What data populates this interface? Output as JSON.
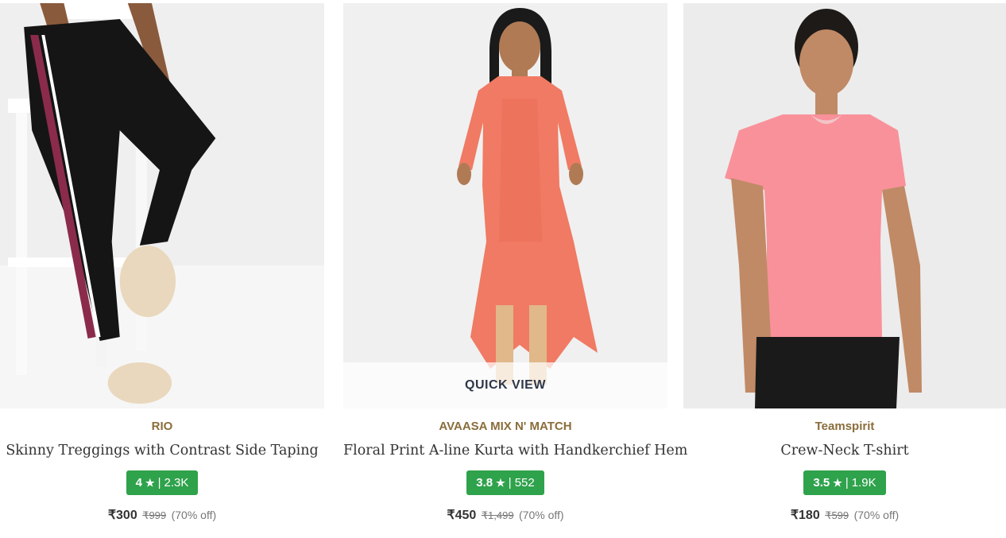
{
  "products": [
    {
      "brand": "RIO",
      "title": "Skinny Treggings with Contrast Side Taping",
      "rating": "4",
      "rating_count": "2.3K",
      "price": "₹300",
      "mrp": "₹999",
      "discount": "(70% off)",
      "colors": {
        "main": "#151515",
        "accent": "#8b2b4b",
        "bg": "#eeeeee"
      }
    },
    {
      "brand": "AVAASA MIX N' MATCH",
      "title": "Floral Print A-line Kurta with Handkerchief Hem",
      "rating": "3.8",
      "rating_count": "552",
      "price": "₹450",
      "mrp": "₹1,499",
      "discount": "(70% off)",
      "quick_view_label": "QUICK VIEW",
      "colors": {
        "main": "#f07a63",
        "accent": "#e0b88a",
        "bg": "#f0f0f0"
      }
    },
    {
      "brand": "Teamspirit",
      "title": "Crew-Neck T-shirt",
      "rating": "3.5",
      "rating_count": "1.9K",
      "price": "₹180",
      "mrp": "₹599",
      "discount": "(70% off)",
      "colors": {
        "main": "#f9919a",
        "accent": "#1a1a1a",
        "bg": "#ececec"
      }
    }
  ],
  "rating_star": "★",
  "rating_separator": "|",
  "colors": {
    "rating_badge": "#2fa24c",
    "brand_text": "#8a6d3b"
  }
}
